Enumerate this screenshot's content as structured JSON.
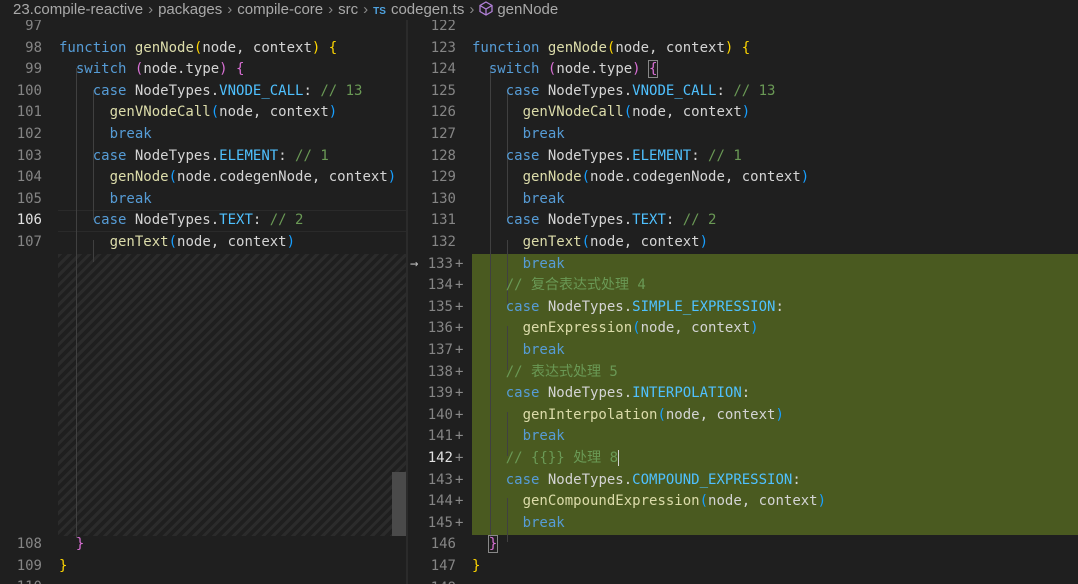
{
  "breadcrumb": {
    "items": [
      "23.compile-reactive",
      "packages",
      "compile-core",
      "src",
      "codegen.ts",
      "genNode"
    ],
    "ts_badge": "TS",
    "separator": "›"
  },
  "left": {
    "lines": [
      {
        "n": "97",
        "text": ""
      },
      {
        "n": "98",
        "text": "function genNode(node, context) {"
      },
      {
        "n": "99",
        "text": "  switch (node.type) {"
      },
      {
        "n": "100",
        "text": "    case NodeTypes.VNODE_CALL: // 13"
      },
      {
        "n": "101",
        "text": "      genVNodeCall(node, context)"
      },
      {
        "n": "102",
        "text": "      break"
      },
      {
        "n": "103",
        "text": "    case NodeTypes.ELEMENT: // 1"
      },
      {
        "n": "104",
        "text": "      genNode(node.codegenNode, context)"
      },
      {
        "n": "105",
        "text": "      break"
      },
      {
        "n": "106",
        "text": "    case NodeTypes.TEXT: // 2"
      },
      {
        "n": "107",
        "text": "      genText(node, context)"
      },
      {
        "n": "108",
        "text": "  }"
      },
      {
        "n": "109",
        "text": "}"
      },
      {
        "n": "110",
        "text": ""
      }
    ]
  },
  "right": {
    "lines": [
      {
        "n": "122",
        "text": ""
      },
      {
        "n": "123",
        "text": "function genNode(node, context) {"
      },
      {
        "n": "124",
        "text": "  switch (node.type) {"
      },
      {
        "n": "125",
        "text": "    case NodeTypes.VNODE_CALL: // 13"
      },
      {
        "n": "126",
        "text": "      genVNodeCall(node, context)"
      },
      {
        "n": "127",
        "text": "      break"
      },
      {
        "n": "128",
        "text": "    case NodeTypes.ELEMENT: // 1"
      },
      {
        "n": "129",
        "text": "      genNode(node.codegenNode, context)"
      },
      {
        "n": "130",
        "text": "      break"
      },
      {
        "n": "131",
        "text": "    case NodeTypes.TEXT: // 2"
      },
      {
        "n": "132",
        "text": "      genText(node, context)"
      },
      {
        "n": "133",
        "text": "      break"
      },
      {
        "n": "134",
        "text": "    // 复合表达式处理 4"
      },
      {
        "n": "135",
        "text": "    case NodeTypes.SIMPLE_EXPRESSION:"
      },
      {
        "n": "136",
        "text": "      genExpression(node, context)"
      },
      {
        "n": "137",
        "text": "      break"
      },
      {
        "n": "138",
        "text": "    // 表达式处理 5"
      },
      {
        "n": "139",
        "text": "    case NodeTypes.INTERPOLATION:"
      },
      {
        "n": "140",
        "text": "      genInterpolation(node, context)"
      },
      {
        "n": "141",
        "text": "      break"
      },
      {
        "n": "142",
        "text": "    // {{}} 处理 8"
      },
      {
        "n": "143",
        "text": "    case NodeTypes.COMPOUND_EXPRESSION:"
      },
      {
        "n": "144",
        "text": "      genCompoundExpression(node, context)"
      },
      {
        "n": "145",
        "text": "      break"
      },
      {
        "n": "146",
        "text": "  }"
      },
      {
        "n": "147",
        "text": "}"
      },
      {
        "n": "148",
        "text": ""
      }
    ],
    "added_marker": "+",
    "arrow": "→"
  },
  "colors": {
    "background": "#1f1f1f",
    "added_line": "#4a5a20",
    "keyword": "#569cd6",
    "function": "#dcdcaa",
    "enum_member": "#4fc1ff",
    "comment": "#6a9955"
  }
}
